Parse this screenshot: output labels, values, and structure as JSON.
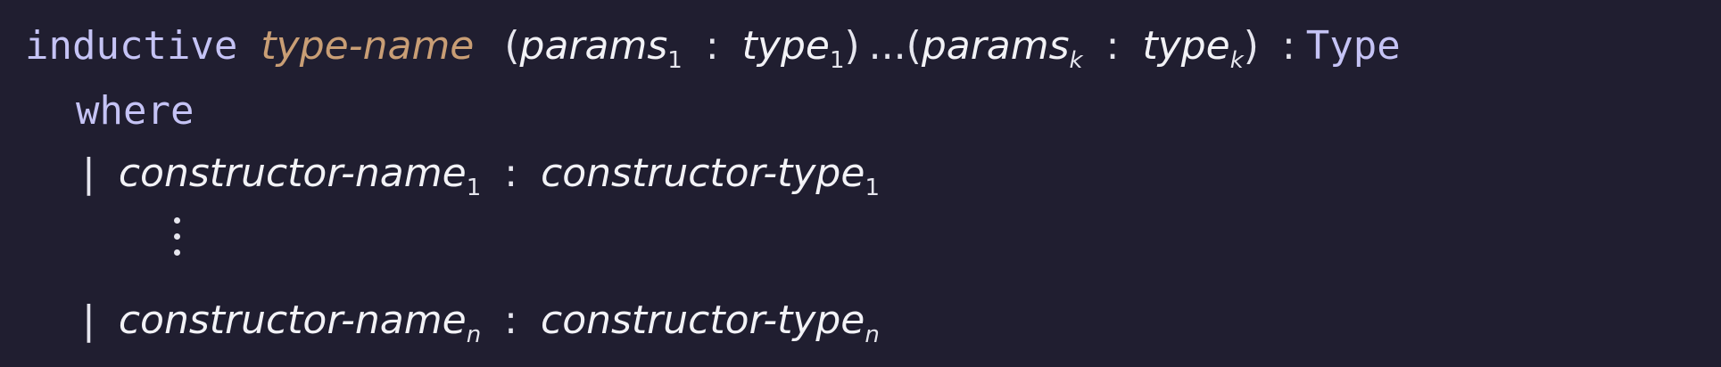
{
  "signature": {
    "keyword_inductive": "inductive",
    "type_name": "type-name",
    "open_paren": "(",
    "close_paren": ")",
    "params": "params",
    "sub_1": "1",
    "colon": ":",
    "type": "type",
    "ellipsis": "...",
    "sub_k": "k",
    "result_type": "Type"
  },
  "where_keyword": "where",
  "constructors": {
    "bar": "|",
    "name": "constructor-name",
    "type": "constructor-type",
    "sub_1": "1",
    "sub_n": "n",
    "colon": ":"
  },
  "colors": {
    "background": "#201e30",
    "keyword": "#c5c3f5",
    "type_name": "#c99e75",
    "text": "#e6e6ee"
  }
}
